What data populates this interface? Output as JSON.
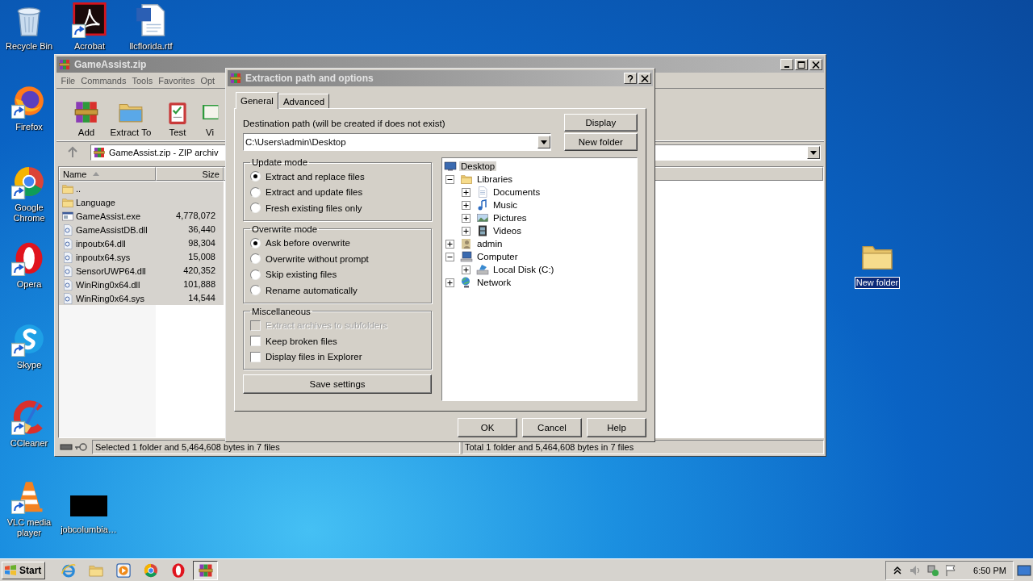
{
  "desktop_icons": [
    {
      "label": "Recycle Bin",
      "kind": "recycle-bin",
      "shortcut": false,
      "selected": false
    },
    {
      "label": "Acrobat",
      "kind": "acrobat",
      "shortcut": true,
      "selected": false
    },
    {
      "label": "llcflorida.rtf",
      "kind": "word-doc",
      "shortcut": false,
      "selected": false
    },
    {
      "label": "Firefox",
      "kind": "firefox",
      "shortcut": true,
      "selected": false
    },
    {
      "label": "Google Chrome",
      "kind": "chrome",
      "shortcut": true,
      "selected": false
    },
    {
      "label": "Opera",
      "kind": "opera",
      "shortcut": true,
      "selected": false
    },
    {
      "label": "Skype",
      "kind": "skype",
      "shortcut": true,
      "selected": false
    },
    {
      "label": "CCleaner",
      "kind": "ccleaner",
      "shortcut": true,
      "selected": false
    },
    {
      "label": "VLC media player",
      "kind": "vlc",
      "shortcut": true,
      "selected": false
    },
    {
      "label": "jobcolumbia…",
      "kind": "black-thumb",
      "shortcut": false,
      "selected": false
    },
    {
      "label": "New folder",
      "kind": "folder",
      "shortcut": false,
      "selected": true
    }
  ],
  "winrar": {
    "title": "GameAssist.zip",
    "menu": [
      "File",
      "Commands",
      "Tools",
      "Favorites",
      "Opt"
    ],
    "toolbar": [
      {
        "label": "Add",
        "kind": "add"
      },
      {
        "label": "Extract To",
        "kind": "extract"
      },
      {
        "label": "Test",
        "kind": "test"
      },
      {
        "label": "Vi",
        "kind": "view"
      }
    ],
    "address": "GameAssist.zip - ZIP archiv",
    "columns": [
      "Name",
      "Size"
    ],
    "rows": [
      {
        "name": "..",
        "kind": "folder",
        "selected": true
      },
      {
        "name": "Language",
        "kind": "folder",
        "selected": true
      },
      {
        "name": "GameAssist.exe",
        "size": "4,778,072",
        "kind": "exe",
        "selected": true
      },
      {
        "name": "GameAssistDB.dll",
        "size": "36,440",
        "kind": "file",
        "selected": true
      },
      {
        "name": "inpoutx64.dll",
        "size": "98,304",
        "kind": "file",
        "selected": true
      },
      {
        "name": "inpoutx64.sys",
        "size": "15,008",
        "kind": "file",
        "selected": true
      },
      {
        "name": "SensorUWP64.dll",
        "size": "420,352",
        "kind": "file",
        "selected": true
      },
      {
        "name": "WinRing0x64.dll",
        "size": "101,888",
        "kind": "file",
        "selected": true
      },
      {
        "name": "WinRing0x64.sys",
        "size": "14,544",
        "kind": "file",
        "selected": true
      }
    ],
    "status_left": "Selected 1 folder and 5,464,608 bytes in 7 files",
    "status_right": "Total 1 folder and 5,464,608 bytes in 7 files"
  },
  "dialog": {
    "title": "Extraction path and options",
    "tabs": [
      {
        "label": "General",
        "selected": true
      },
      {
        "label": "Advanced",
        "selected": false
      }
    ],
    "destination_label": "Destination path (will be created if does not exist)",
    "destination_value": "C:\\Users\\admin\\Desktop",
    "side_buttons": [
      "Display",
      "New folder"
    ],
    "groups": [
      {
        "title": "Update mode",
        "kind": "radio",
        "options": [
          {
            "label": "Extract and replace files",
            "selected": true
          },
          {
            "label": "Extract and update files",
            "selected": false
          },
          {
            "label": "Fresh existing files only",
            "selected": false
          }
        ]
      },
      {
        "title": "Overwrite mode",
        "kind": "radio",
        "options": [
          {
            "label": "Ask before overwrite",
            "selected": true
          },
          {
            "label": "Overwrite without prompt",
            "selected": false
          },
          {
            "label": "Skip existing files",
            "selected": false
          },
          {
            "label": "Rename automatically",
            "selected": false
          }
        ]
      },
      {
        "title": "Miscellaneous",
        "kind": "checkbox",
        "options": [
          {
            "label": "Extract archives to subfolders",
            "checked": false,
            "disabled": true
          },
          {
            "label": "Keep broken files",
            "checked": false,
            "disabled": false
          },
          {
            "label": "Display files in Explorer",
            "checked": false,
            "disabled": false
          }
        ]
      }
    ],
    "save_button": "Save settings",
    "tree": [
      {
        "label": "Desktop",
        "kind": "desktop",
        "selected": true,
        "children": [
          {
            "label": "Libraries",
            "kind": "libraries",
            "expanded": true,
            "selected": false,
            "children": [
              {
                "label": "Documents",
                "kind": "documents",
                "expanded": false,
                "selected": false
              },
              {
                "label": "Music",
                "kind": "music",
                "expanded": false,
                "selected": false
              },
              {
                "label": "Pictures",
                "kind": "pictures",
                "expanded": false,
                "selected": false
              },
              {
                "label": "Videos",
                "kind": "videos",
                "expanded": false,
                "selected": false
              }
            ]
          },
          {
            "label": "admin",
            "kind": "user",
            "expanded": false,
            "selected": false
          },
          {
            "label": "Computer",
            "kind": "computer",
            "expanded": true,
            "selected": false,
            "children": [
              {
                "label": "Local Disk (C:)",
                "kind": "disk",
                "expanded": false,
                "selected": false
              }
            ]
          },
          {
            "label": "Network",
            "kind": "network",
            "expanded": false,
            "selected": false
          }
        ]
      }
    ],
    "buttons": [
      "OK",
      "Cancel",
      "Help"
    ]
  },
  "taskbar": {
    "start": "Start",
    "apps": [
      {
        "kind": "ie",
        "active": false
      },
      {
        "kind": "explorer",
        "active": false
      },
      {
        "kind": "media-player",
        "active": false
      },
      {
        "kind": "chrome",
        "active": false
      },
      {
        "kind": "opera",
        "active": false
      },
      {
        "kind": "winrar",
        "active": true
      }
    ],
    "clock": "6:50 PM"
  }
}
